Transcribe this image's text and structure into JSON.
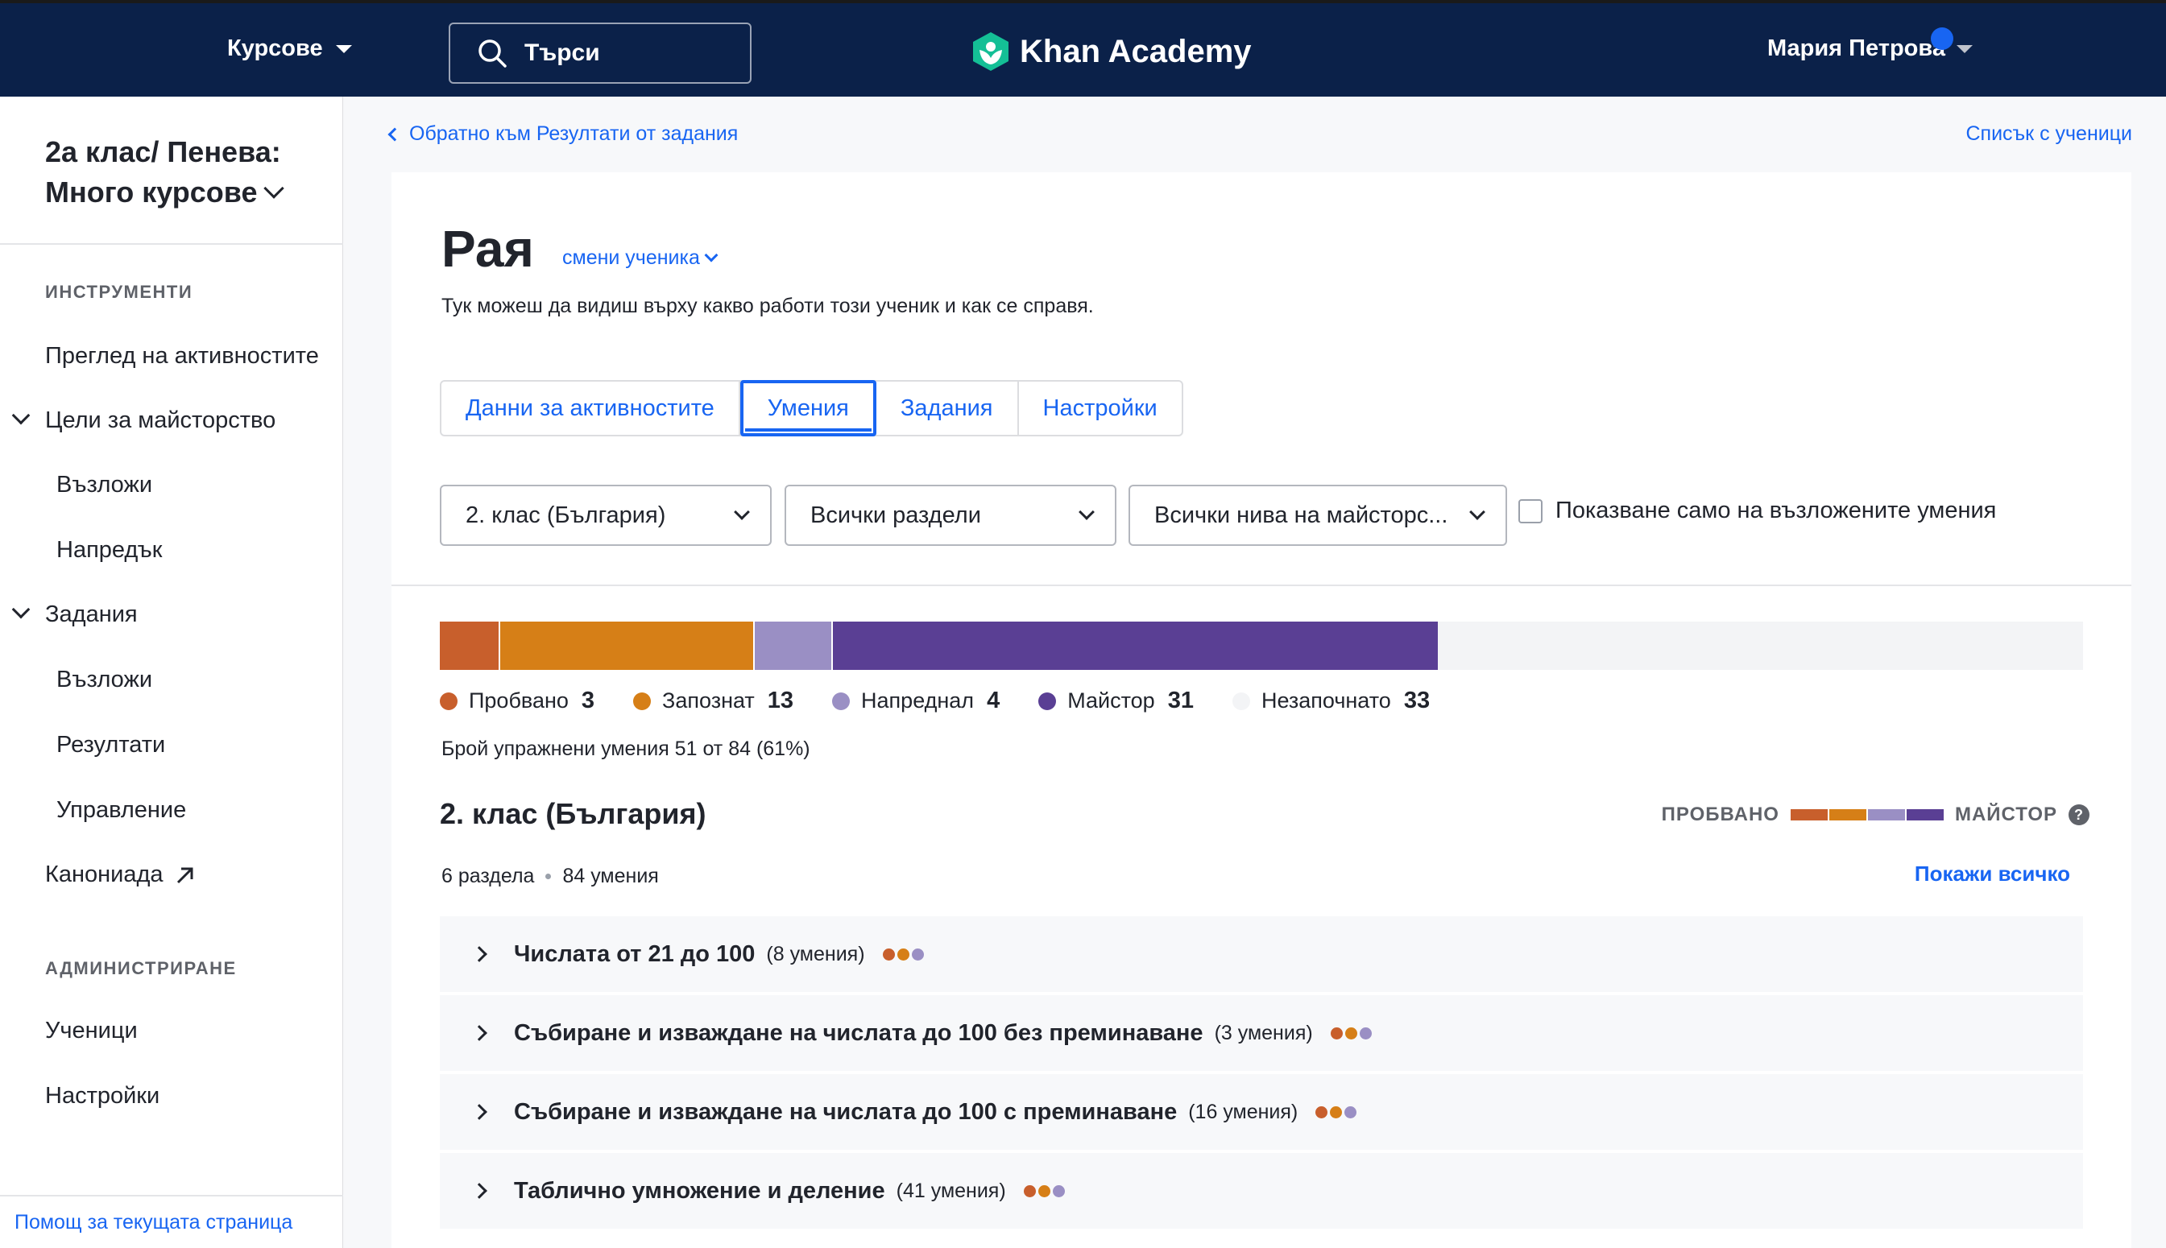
{
  "topnav": {
    "courses_label": "Курсове",
    "search_placeholder": "Търси",
    "logo_text": "Khan Academy",
    "user_name": "Мария Петрова"
  },
  "sidebar": {
    "class_title": "2а клас/ Пенева: Много курсове",
    "section_tools": "ИНСТРУМЕНТИ",
    "items": [
      {
        "label": "Преглед на активностите"
      },
      {
        "label": "Цели за майсторство"
      },
      {
        "label": "Възложи"
      },
      {
        "label": "Напредък"
      },
      {
        "label": "Задания"
      },
      {
        "label": "Възложи"
      },
      {
        "label": "Резултати"
      },
      {
        "label": "Управление"
      },
      {
        "label": "Канониада"
      }
    ],
    "section_admin": "АДМИНИСТРИРАНЕ",
    "admin_items": [
      {
        "label": "Ученици"
      },
      {
        "label": "Настройки"
      }
    ],
    "help_link": "Помощ за текущата страница"
  },
  "header": {
    "back_link": "Обратно към Резултати от задания",
    "students_link": "Списък с ученици"
  },
  "student": {
    "name": "Рая",
    "change_label": "смени ученика",
    "subtitle": "Тук можеш да видиш върху какво работи този ученик и как се справя."
  },
  "tabs": [
    {
      "label": "Данни за активностите",
      "active": false
    },
    {
      "label": "Умения",
      "active": true
    },
    {
      "label": "Задания",
      "active": false
    },
    {
      "label": "Настройки",
      "active": false
    }
  ],
  "filters": {
    "course": "2. клас (България)",
    "units": "Всички раздели",
    "mastery_levels": "Всички нива на майсторс...",
    "assigned_only_label": "Показване само на възложените умения",
    "assigned_only_checked": false
  },
  "mastery": {
    "total": 84,
    "levels": [
      {
        "name": "Пробвано",
        "count": "3",
        "value": 3,
        "color": "#c85f2c"
      },
      {
        "name": "Запознат",
        "count": "13",
        "value": 13,
        "color": "#d67f17"
      },
      {
        "name": "Напреднал",
        "count": "4",
        "value": 4,
        "color": "#9a8fc4"
      },
      {
        "name": "Майстор",
        "count": "31",
        "value": 31,
        "color": "#5a3f94"
      },
      {
        "name": "Незапочнато",
        "count": "33",
        "value": 33,
        "color": "#f3f4f6"
      }
    ],
    "exercised_text": "Брой упражнени умения 51 от 84 (61%)"
  },
  "course_section": {
    "title": "2. клас (България)",
    "scale_low": "ПРОБВАНО",
    "scale_high": "МАЙСТОР",
    "units_count": "6 раздела",
    "skills_count": "84 умения",
    "show_all": "Покажи всичко",
    "units": [
      {
        "title": "Числата от 21 до 100",
        "count": "(8 умения)"
      },
      {
        "title": "Събиране и изваждане на числата до 100 без преминаване",
        "count": "(3 умения)"
      },
      {
        "title": "Събиране и изваждане на числата до 100 с преминаване",
        "count": "(16 умения)"
      },
      {
        "title": "Таблично умножение и деление",
        "count": "(41 умения)"
      }
    ]
  }
}
